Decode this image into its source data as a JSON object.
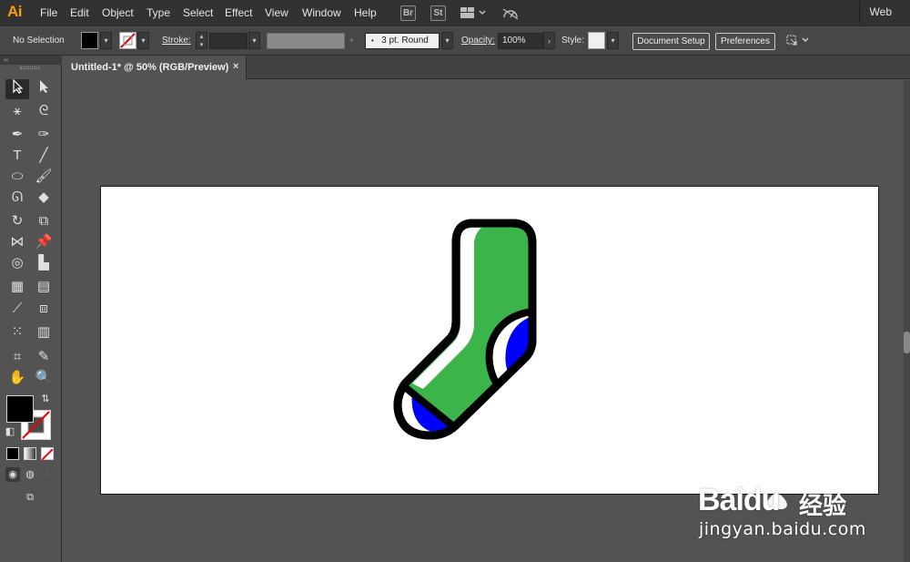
{
  "app": {
    "logo": "Ai",
    "menu": [
      "File",
      "Edit",
      "Object",
      "Type",
      "Select",
      "Effect",
      "View",
      "Window",
      "Help"
    ],
    "bridge_badge": "Br",
    "stock_badge": "St",
    "workspace": "Web"
  },
  "control_bar": {
    "selection_label": "No Selection",
    "stroke_label": "Stroke:",
    "brush_profile": "3 pt. Round",
    "opacity_label": "Opacity:",
    "opacity_value": "100%",
    "style_label": "Style:",
    "document_setup_label": "Document Setup",
    "preferences_label": "Preferences"
  },
  "document": {
    "tab_title": "Untitled-1* @ 50% (RGB/Preview)",
    "close_glyph": "×"
  },
  "colors": {
    "sock_green": "#3bb54a",
    "sock_blue": "#0000ff",
    "outline": "#000000",
    "artboard": "#ffffff",
    "fill_swatch": "#000000",
    "stroke_swatch": "none"
  },
  "watermark": {
    "logo_text": "Baidu",
    "logo_cn": "经验",
    "url": "jingyan.baidu.com"
  }
}
